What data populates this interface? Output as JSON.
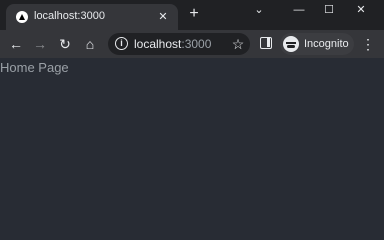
{
  "tab": {
    "favicon": "vercel-triangle-icon",
    "title": "localhost:3000",
    "close_icon": "close-icon"
  },
  "tabstrip": {
    "new_tab_icon": "plus-icon",
    "window_controls": [
      "chevron-down-icon",
      "minimize-icon",
      "maximize-icon",
      "close-icon"
    ]
  },
  "toolbar": {
    "back_icon": "back-arrow-icon",
    "forward_icon": "forward-arrow-icon",
    "reload_icon": "reload-icon",
    "home_icon": "home-icon",
    "omnibox": {
      "host": "localhost",
      "port": ":3000",
      "info_icon": "info-icon",
      "bookmark_icon": "star-icon"
    },
    "side_panel_icon": "side-panel-icon",
    "profile_label": "Incognito",
    "menu_icon": "more-vert-icon"
  },
  "page": {
    "text": "Home Page",
    "background": "#282c34",
    "text_color": "#9aa0a6"
  }
}
